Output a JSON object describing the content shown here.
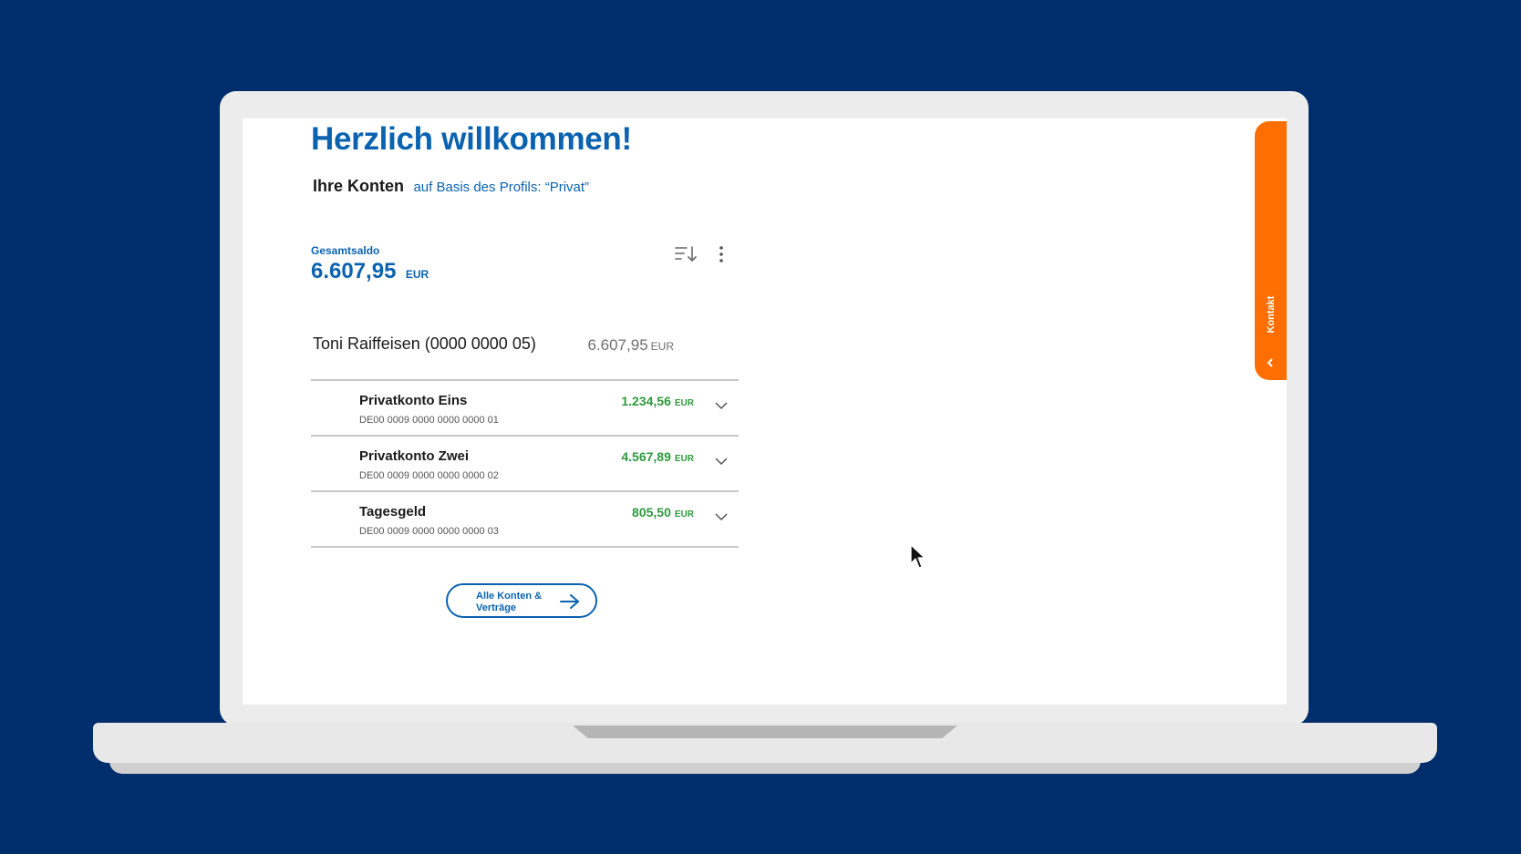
{
  "colors": {
    "background": "#002d6b",
    "brand_blue": "#0b63b0",
    "positive_green": "#2e9a3f",
    "contact_orange": "#ff6e00"
  },
  "page": {
    "title": "Herzlich willkommen!",
    "accounts_heading": "Ihre Konten",
    "profile_note": "auf Basis des Profils: “Privat”"
  },
  "summary": {
    "label": "Gesamtsaldo",
    "value": "6.607,95",
    "currency": "EUR"
  },
  "toolbar": {
    "sort_icon": "sort-descending-icon",
    "more_icon": "more-vertical-icon"
  },
  "owner": {
    "name": "Toni Raiffeisen (0000 0000 05)",
    "balance": "6.607,95",
    "currency": "EUR"
  },
  "accounts": [
    {
      "name": "Privatkonto Eins",
      "iban": "DE00 0009 0000 0000 0000 01",
      "balance": "1.234,56",
      "currency": "EUR"
    },
    {
      "name": "Privatkonto Zwei",
      "iban": "DE00 0009 0000 0000 0000 02",
      "balance": "4.567,89",
      "currency": "EUR"
    },
    {
      "name": "Tagesgeld",
      "iban": "DE00 0009 0000 0000 0000 03",
      "balance": "805,50",
      "currency": "EUR"
    }
  ],
  "all_accounts_button": {
    "label": "Alle Konten & Verträge",
    "icon": "arrow-right-icon"
  },
  "contact_tab": {
    "label": "Kontakt",
    "icon": "chevron-left-icon"
  }
}
